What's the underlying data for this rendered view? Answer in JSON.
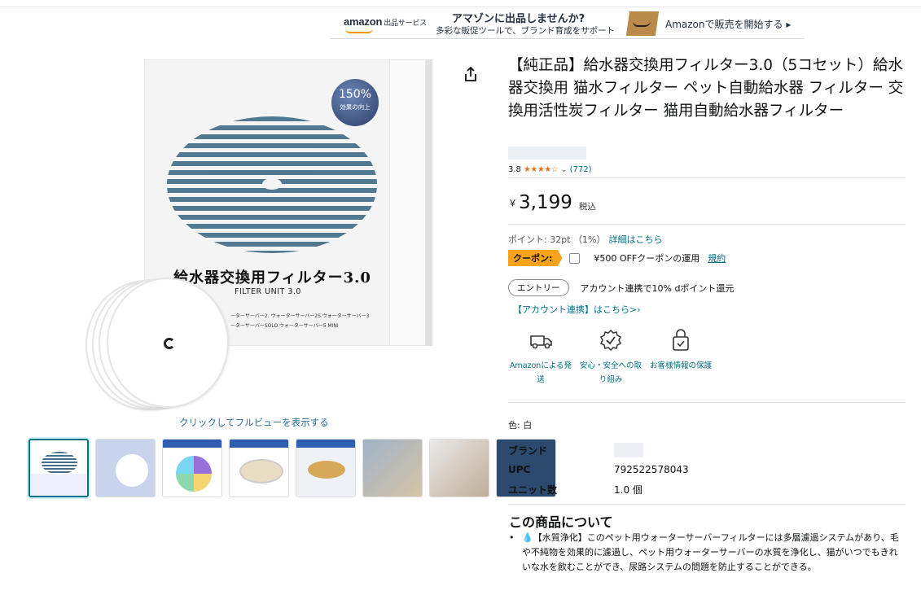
{
  "banner": {
    "logo": "amazon",
    "logo_service": "出品サービス",
    "headline": "アマゾンに出品しませんか?",
    "subline": "多彩な販促ツールで、ブランド育成をサポート",
    "cta": "Amazonで販売を開始する ▸"
  },
  "image": {
    "badge_percent": "150%",
    "badge_sub": "効果の向上",
    "box_title": "給水器交換用フィルター3.0",
    "box_subtitle": "FILTER UNIT 3.0",
    "box_small_1": "ーターサーバー2. ウォーターサーバー2S.ウォーターサーバー3",
    "box_small_2": "ーターサーバーSOLO.ウォーターサーバー5 MINI",
    "click_hint": "クリックしてフルビューを表示する",
    "thumbnail_count": 8
  },
  "product": {
    "title": "【純正品】給水器交換用フィルター3.0（5コセット）給水器交換用 猫水フィルター ペット自動給水器 フィルター 交換用活性炭フィルター 猫用自動給水器フィルター",
    "rating_value": "3.8",
    "rating_stars": "★★★★☆",
    "rating_count": "(772)",
    "price_symbol": "￥",
    "price": "3,199",
    "tax_label": "税込",
    "points_text": "ポイント: 32pt （1%）",
    "points_link": "詳細はこちら",
    "coupon_tag": "クーポン:",
    "coupon_text": "¥500 OFFクーポンの運用",
    "coupon_terms": "規約",
    "entry_button": "エントリー",
    "entry_text": "アカウント連携で10% dポイント還元",
    "account_link": "【アカウント連携】はこちら>›",
    "features": [
      {
        "label": "Amazonによる発送",
        "icon": "delivery-truck-icon"
      },
      {
        "label": "安心・安全への取り組み",
        "icon": "safety-badge-icon"
      },
      {
        "label": "お客様情報の保護",
        "icon": "privacy-lock-icon"
      }
    ],
    "color_label": "色: 白"
  },
  "specs": [
    {
      "key": "ブランド",
      "value": ""
    },
    {
      "key": "UPC",
      "value": "792522578043"
    },
    {
      "key": "ユニット数",
      "value": "1.0 個"
    }
  ],
  "about": {
    "title": "この商品について",
    "bullet": "•",
    "item_1": "【水質浄化】このペット用ウォーターサーバーフィルターには多層濾過システムがあり、毛や不純物を効果的に濾過し、ペット用ウォーターサーバーの水質を浄化し、猫がいつでもきれいな水を飲むことができ、尿路システムの問題を防止することができる。"
  },
  "colors": {
    "link": "#007185",
    "coupon": "#f7a31c",
    "star": "#de7921",
    "thumb_active": "#007185"
  }
}
